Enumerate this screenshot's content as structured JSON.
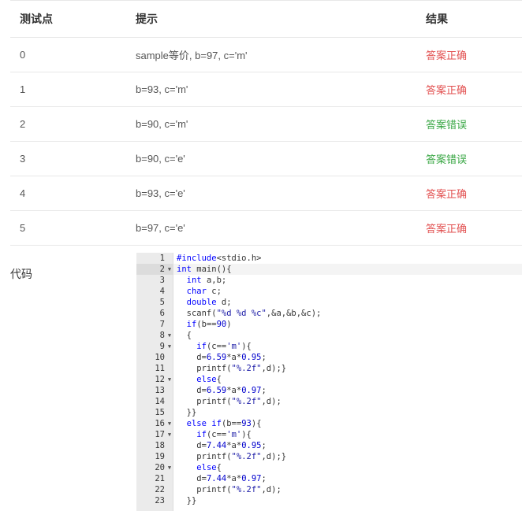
{
  "table": {
    "headers": {
      "id": "测试点",
      "hint": "提示",
      "result": "结果"
    },
    "rows": [
      {
        "id": "0",
        "hint": "sample等价, b=97, c='m'",
        "result": "答案正确",
        "status": "pass"
      },
      {
        "id": "1",
        "hint": "b=93, c='m'",
        "result": "答案正确",
        "status": "pass"
      },
      {
        "id": "2",
        "hint": "b=90, c='m'",
        "result": "答案错误",
        "status": "fail"
      },
      {
        "id": "3",
        "hint": "b=90, c='e'",
        "result": "答案错误",
        "status": "fail"
      },
      {
        "id": "4",
        "hint": "b=93, c='e'",
        "result": "答案正确",
        "status": "pass"
      },
      {
        "id": "5",
        "hint": "b=97, c='e'",
        "result": "答案正确",
        "status": "pass"
      }
    ]
  },
  "colors": {
    "pass": "#e25050",
    "fail": "#3aa745"
  },
  "code_section": {
    "label": "代码",
    "active_line": 2,
    "lines": [
      {
        "n": "1",
        "fold": false,
        "text": "#include<stdio.h>"
      },
      {
        "n": "2",
        "fold": true,
        "text": "int main(){"
      },
      {
        "n": "3",
        "fold": false,
        "text": "  int a,b;"
      },
      {
        "n": "4",
        "fold": false,
        "text": "  char c;"
      },
      {
        "n": "5",
        "fold": false,
        "text": "  double d;"
      },
      {
        "n": "6",
        "fold": false,
        "text": "  scanf(\"%d %d %c\",&a,&b,&c);"
      },
      {
        "n": "7",
        "fold": false,
        "text": "  if(b==90)"
      },
      {
        "n": "8",
        "fold": true,
        "text": "  {"
      },
      {
        "n": "9",
        "fold": true,
        "text": "    if(c=='m'){"
      },
      {
        "n": "10",
        "fold": false,
        "text": "    d=6.59*a*0.95;"
      },
      {
        "n": "11",
        "fold": false,
        "text": "    printf(\"%.2f\",d);}"
      },
      {
        "n": "12",
        "fold": true,
        "text": "    else{"
      },
      {
        "n": "13",
        "fold": false,
        "text": "    d=6.59*a*0.97;"
      },
      {
        "n": "14",
        "fold": false,
        "text": "    printf(\"%.2f\",d);"
      },
      {
        "n": "15",
        "fold": false,
        "text": "  }}"
      },
      {
        "n": "16",
        "fold": true,
        "text": "  else if(b==93){"
      },
      {
        "n": "17",
        "fold": true,
        "text": "    if(c=='m'){"
      },
      {
        "n": "18",
        "fold": false,
        "text": "    d=7.44*a*0.95;"
      },
      {
        "n": "19",
        "fold": false,
        "text": "    printf(\"%.2f\",d);}"
      },
      {
        "n": "20",
        "fold": true,
        "text": "    else{"
      },
      {
        "n": "21",
        "fold": false,
        "text": "    d=7.44*a*0.97;"
      },
      {
        "n": "22",
        "fold": false,
        "text": "    printf(\"%.2f\",d);"
      },
      {
        "n": "23",
        "fold": false,
        "text": "  }}"
      }
    ]
  }
}
